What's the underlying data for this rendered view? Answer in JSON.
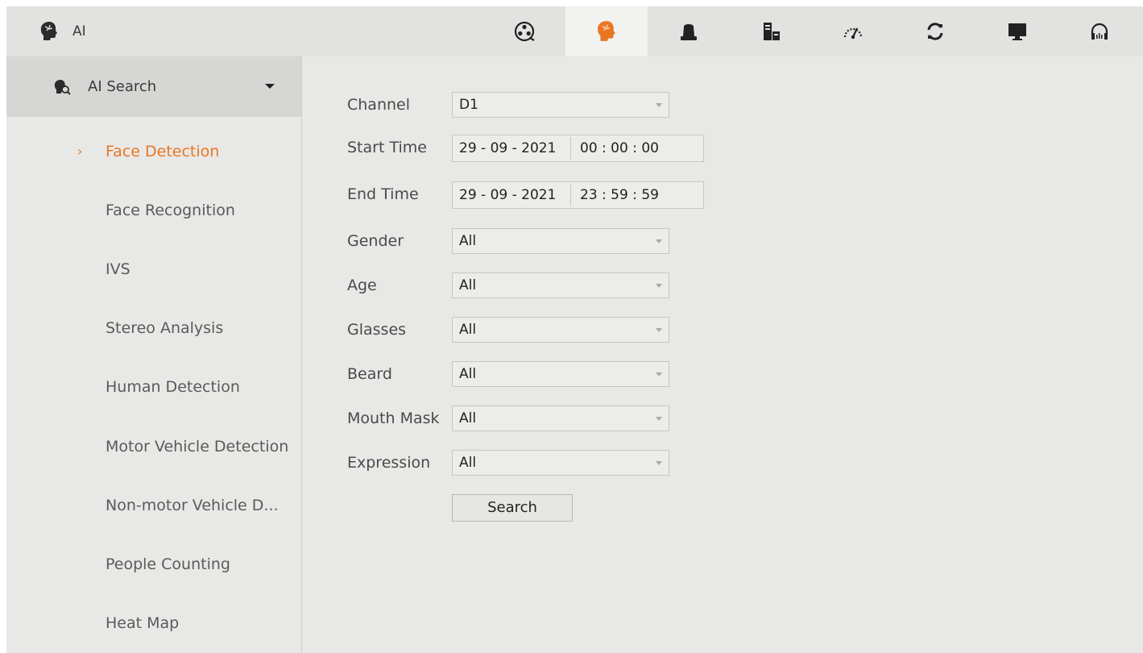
{
  "app": {
    "title": "AI"
  },
  "toolbar": {
    "icons": [
      {
        "name": "film-reel-icon"
      },
      {
        "name": "ai-head-icon",
        "active": true
      },
      {
        "name": "alarm-light-icon"
      },
      {
        "name": "storage-icon"
      },
      {
        "name": "speedometer-icon"
      },
      {
        "name": "refresh-icon"
      },
      {
        "name": "monitor-icon"
      },
      {
        "name": "headset-icon"
      }
    ]
  },
  "sidebar": {
    "header": {
      "label": "AI Search"
    },
    "items": [
      {
        "label": "Face Detection",
        "active": true
      },
      {
        "label": "Face Recognition"
      },
      {
        "label": "IVS"
      },
      {
        "label": "Stereo Analysis"
      },
      {
        "label": "Human Detection"
      },
      {
        "label": "Motor Vehicle Detection"
      },
      {
        "label": "Non-motor Vehicle D..."
      },
      {
        "label": "People Counting"
      },
      {
        "label": "Heat Map"
      }
    ]
  },
  "form": {
    "channel": {
      "label": "Channel",
      "value": "D1"
    },
    "start_time": {
      "label": "Start Time",
      "date": "29 - 09 - 2021",
      "time": "00 : 00 : 00"
    },
    "end_time": {
      "label": "End Time",
      "date": "29 - 09 - 2021",
      "time": "23 : 59 : 59"
    },
    "gender": {
      "label": "Gender",
      "value": "All"
    },
    "age": {
      "label": "Age",
      "value": "All"
    },
    "glasses": {
      "label": "Glasses",
      "value": "All"
    },
    "beard": {
      "label": "Beard",
      "value": "All"
    },
    "mouth_mask": {
      "label": "Mouth Mask",
      "value": "All"
    },
    "expression": {
      "label": "Expression",
      "value": "All"
    },
    "search_label": "Search"
  },
  "colors": {
    "accent": "#e87722",
    "background": "#e8e8e6",
    "topbar": "#e2e2e0"
  }
}
